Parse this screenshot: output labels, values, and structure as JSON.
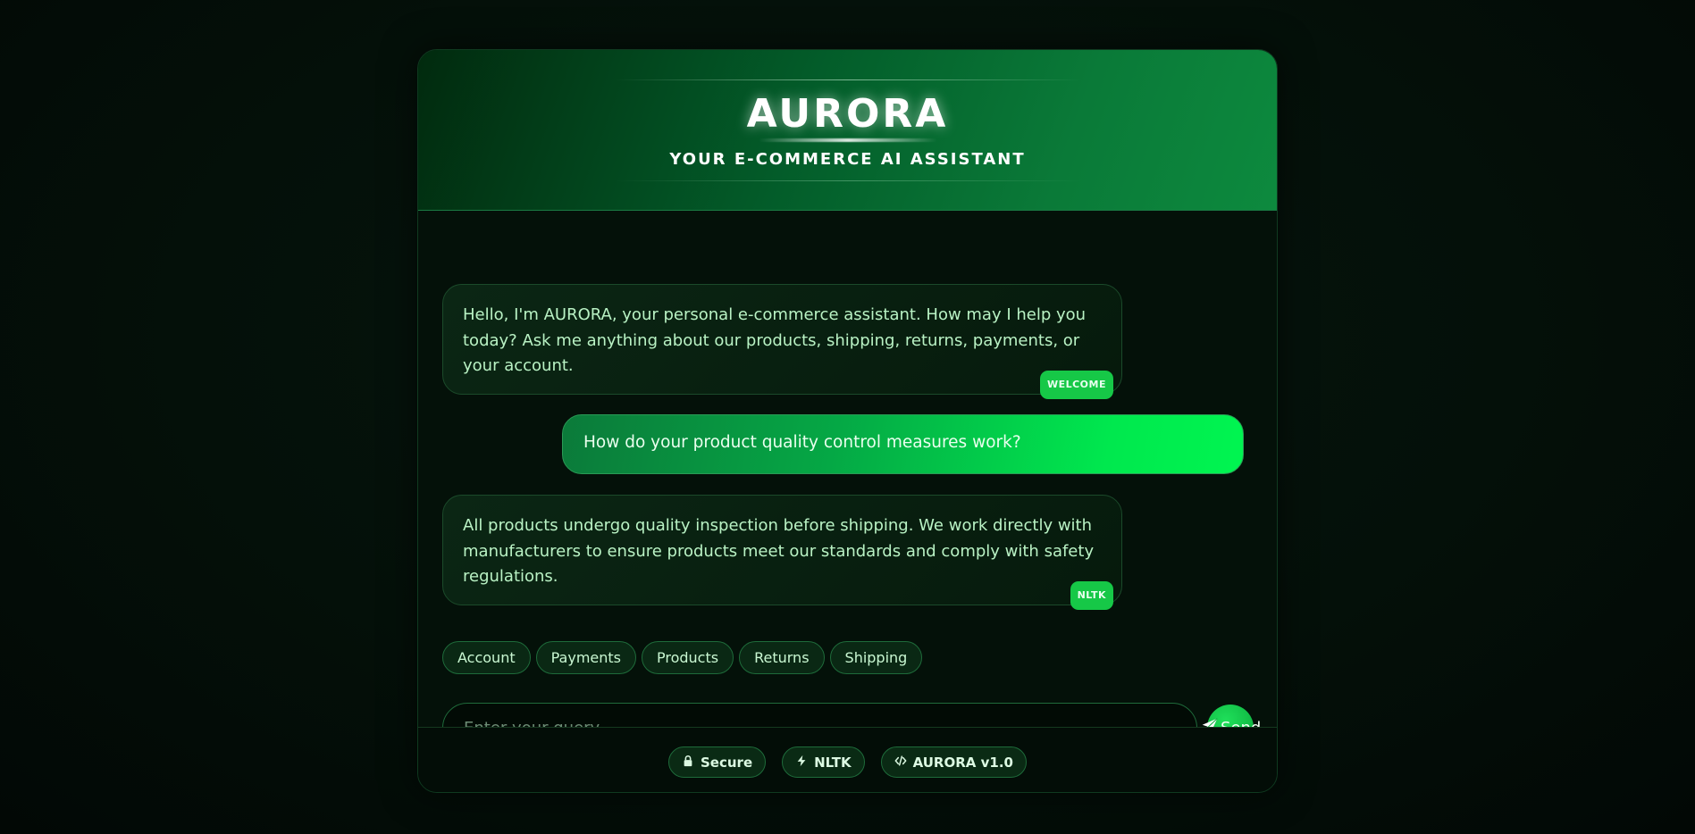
{
  "header": {
    "title": "AURORA",
    "subtitle": "YOUR E-COMMERCE AI ASSISTANT"
  },
  "messages": [
    {
      "role": "bot",
      "text": "Hello, I'm AURORA, your personal e-commerce assistant. How may I help you today? Ask me anything about our products, shipping, returns, payments, or your account.",
      "tag": "WELCOME"
    },
    {
      "role": "user",
      "text": "How do your product quality control measures work?"
    },
    {
      "role": "bot",
      "text": "All products undergo quality inspection before shipping. We work directly with manufacturers to ensure products meet our standards and comply with safety regulations.",
      "tag": "NLTK"
    }
  ],
  "quick_topics": [
    "Account",
    "Payments",
    "Products",
    "Returns",
    "Shipping"
  ],
  "input": {
    "placeholder": "Enter your query...",
    "value": ""
  },
  "send_button": {
    "label": "Send",
    "icon": "paper-plane-icon"
  },
  "footer": {
    "badges": [
      {
        "label": "Secure",
        "icon": "lock-icon"
      },
      {
        "label": "NLTK",
        "icon": "bolt-icon"
      },
      {
        "label": "AURORA v1.0",
        "icon": "code-icon"
      }
    ]
  },
  "colors": {
    "accent": "#16c847",
    "user_bubble_start": "#0b7a3a",
    "user_bubble_end": "#00f550",
    "header_dark": "#012a0e",
    "header_light": "#0d8a3e"
  }
}
